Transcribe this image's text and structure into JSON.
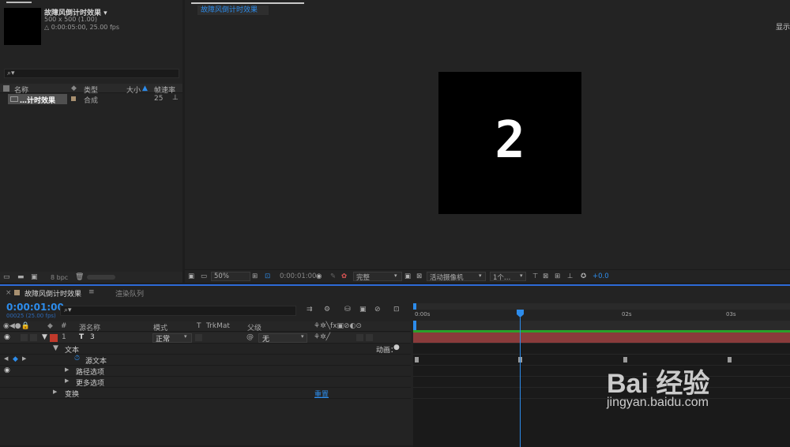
{
  "project": {
    "comp_name": "故障风倒计时效果 ▾",
    "comp_size": "500 x 500 (1.00)",
    "comp_duration": "△ 0:00:05:00, 25.00 fps",
    "search_placeholder": "⌕▾",
    "columns": {
      "name": "名称",
      "type": "类型",
      "size": "大小",
      "fps": "帧速率"
    },
    "item": {
      "name": "…计时效果",
      "type": "合成",
      "fps": "25"
    },
    "bpc": "8 bpc"
  },
  "viewer": {
    "tab_label": "故障风倒计时效果",
    "display_label": "显示",
    "stage_text": "2",
    "toolbar": {
      "zoom": "50%",
      "timecode": "0:00:01:00",
      "resolution": "完整",
      "camera": "活动摄像机",
      "views": "1个…",
      "exposure": "+0.0"
    }
  },
  "timeline": {
    "tab_label": "故障风倒计时效果",
    "tab2_label": "渲染队列",
    "current_time": "0:00:01:00",
    "frame_info": "00025 (25.00 fps)",
    "search_placeholder": "⌕▾",
    "headers": {
      "num": "#",
      "source_name": "源名称",
      "mode": "模式",
      "t": "T",
      "trkmat": "TrkMat",
      "parent": "父级"
    },
    "layer": {
      "num": "1",
      "type_icon": "T",
      "name": "3",
      "mode": "正常",
      "parent": "无"
    },
    "properties": {
      "text": "文本",
      "animate": "动画：",
      "source_text": "源文本",
      "path_options": "路径选项",
      "more_options": "更多选项",
      "transform": "变换",
      "reset": "重置"
    },
    "ruler": [
      "0:00s",
      "02s",
      "03s"
    ],
    "current_marker": "01s"
  },
  "watermark": {
    "brand": "Bai 经验",
    "url": "jingyan.baidu.com"
  },
  "colors": {
    "accent": "#2d8ceb",
    "layer_label": "#c0392b",
    "layer_bar": "#8a3b3b",
    "workarea": "#2aa02a"
  }
}
